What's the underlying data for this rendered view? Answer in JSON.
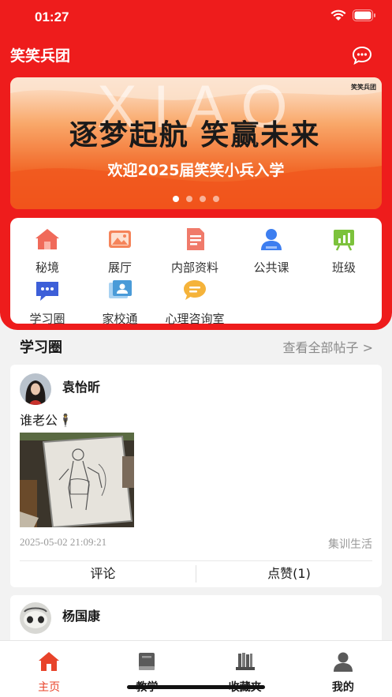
{
  "status_bar": {
    "time": "01:27"
  },
  "header": {
    "title": "笑笑兵团",
    "message_icon": "chat-bubble-icon"
  },
  "banner": {
    "ghost_text": "XIAO",
    "headline": "逐梦起航 笑赢未来",
    "subtitle": "欢迎2025届笑笑小兵入学",
    "logo_text": "笑笑兵团",
    "slide_count": 4,
    "active_slide": 1
  },
  "menu": {
    "items": [
      {
        "label": "秘境",
        "icon": "house-icon",
        "color": "#f06a5a"
      },
      {
        "label": "展厅",
        "icon": "picture-icon",
        "color": "#f5845a"
      },
      {
        "label": "内部资料",
        "icon": "document-icon",
        "color": "#f07a6a"
      },
      {
        "label": "公共课",
        "icon": "person-icon",
        "color": "#3d7ef0"
      },
      {
        "label": "班级",
        "icon": "chart-board-icon",
        "color": "#7cc23c"
      },
      {
        "label": "学习圈",
        "icon": "chat-dots-icon",
        "color": "#3d5fd8"
      },
      {
        "label": "家校通",
        "icon": "contact-card-icon",
        "color": "#4a9bd8"
      },
      {
        "label": "心理咨询室",
        "icon": "speech-bubble-icon",
        "color": "#f5b33a"
      }
    ]
  },
  "feed": {
    "section_title": "学习圈",
    "see_all": "查看全部帖子 >",
    "posts": [
      {
        "author": "袁怡昕",
        "text": "谁老公🕴",
        "date": "2025-05-02 21:09:21",
        "tag": "集训生活",
        "comment_label": "评论",
        "like_label": "点赞(1)"
      },
      {
        "author": "杨国康"
      }
    ]
  },
  "tab_bar": {
    "tabs": [
      {
        "label": "主页",
        "icon": "home-icon",
        "active": true
      },
      {
        "label": "教学",
        "icon": "book-icon",
        "active": false
      },
      {
        "label": "收藏夹",
        "icon": "books-shelf-icon",
        "active": false
      },
      {
        "label": "我的",
        "icon": "user-icon",
        "active": false
      }
    ]
  },
  "colors": {
    "brand_red": "#ee1c1c",
    "active_tab": "#e8432a"
  }
}
